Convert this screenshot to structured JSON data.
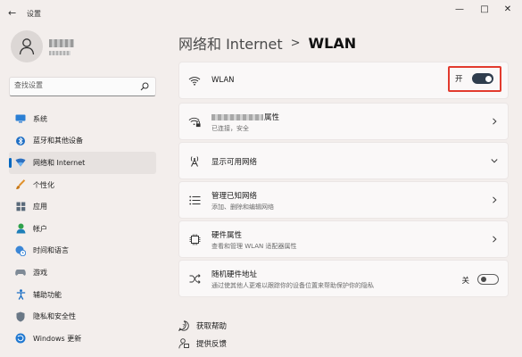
{
  "window": {
    "title": "设置",
    "back_icon": "back-arrow-icon",
    "controls": [
      "minimize-icon",
      "maximize-icon",
      "close-icon"
    ]
  },
  "user": {
    "avatar_icon": "user-icon"
  },
  "search": {
    "placeholder": "查找设置",
    "icon": "search-icon"
  },
  "sidebar": {
    "items": [
      {
        "label": "系统",
        "icon": "system-icon",
        "active": false
      },
      {
        "label": "蓝牙和其他设备",
        "icon": "bluetooth-icon",
        "active": false
      },
      {
        "label": "网络和 Internet",
        "icon": "network-icon",
        "active": true
      },
      {
        "label": "个性化",
        "icon": "brush-icon",
        "active": false
      },
      {
        "label": "应用",
        "icon": "apps-icon",
        "active": false
      },
      {
        "label": "帐户",
        "icon": "account-icon",
        "active": false
      },
      {
        "label": "时间和语言",
        "icon": "globe-clock-icon",
        "active": false
      },
      {
        "label": "游戏",
        "icon": "gamepad-icon",
        "active": false
      },
      {
        "label": "辅助功能",
        "icon": "accessibility-icon",
        "active": false
      },
      {
        "label": "隐私和安全性",
        "icon": "shield-icon",
        "active": false
      },
      {
        "label": "Windows 更新",
        "icon": "windows-update-icon",
        "active": false
      }
    ]
  },
  "breadcrumb": {
    "parent": "网络和 Internet",
    "separator": ">",
    "current": "WLAN"
  },
  "main": {
    "wlan": {
      "label": "WLAN",
      "toggle_label": "开",
      "toggle_on": true
    },
    "connected": {
      "title_suffix": "属性",
      "subtitle": "已连接，安全"
    },
    "available": {
      "title": "显示可用网络"
    },
    "known": {
      "title": "管理已知网络",
      "subtitle": "添加、删除和编辑网络"
    },
    "hardware": {
      "title": "硬件属性",
      "subtitle": "查看和管理 WLAN 适配器属性"
    },
    "random": {
      "title": "随机硬件地址",
      "subtitle": "通过使其他人更难以跟踪你的设备位置来帮助保护你的隐私",
      "toggle_label": "关",
      "toggle_on": false
    }
  },
  "links": {
    "help": "获取帮助",
    "feedback": "提供反馈"
  },
  "colors": {
    "accent": "#0067c0",
    "highlight_box": "#e23b2e",
    "background": "#f3eeec"
  }
}
